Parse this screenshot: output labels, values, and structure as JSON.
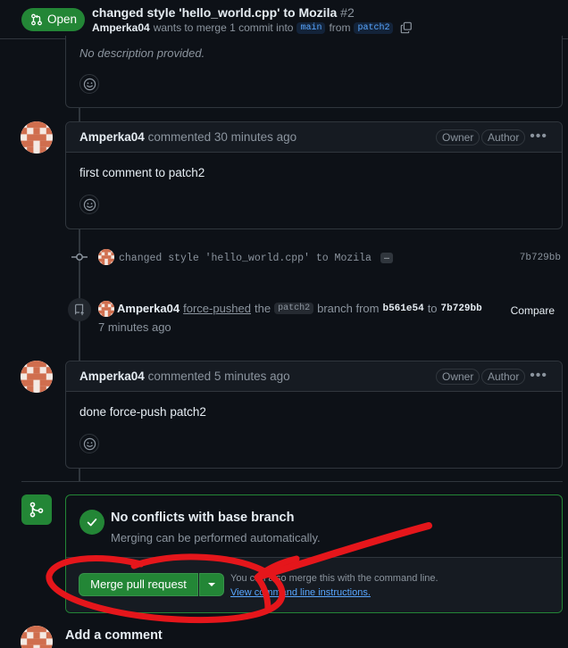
{
  "header": {
    "state": "Open",
    "title": "changed style 'hello_world.cpp' to Mozila",
    "number": "#2",
    "author": "Amperka04",
    "merge_text": "wants to merge 1 commit into",
    "base_branch": "main",
    "from_text": "from",
    "head_branch": "patch2"
  },
  "description": {
    "text": "No description provided."
  },
  "comments": [
    {
      "author": "Amperka04",
      "meta": "commented 30 minutes ago",
      "tags": [
        "Owner",
        "Author"
      ],
      "body": "first comment to patch2"
    },
    {
      "author": "Amperka04",
      "meta": "commented 5 minutes ago",
      "tags": [
        "Owner",
        "Author"
      ],
      "body": "done force-push patch2"
    }
  ],
  "commit_event": {
    "message": "changed style 'hello_world.cpp' to Mozila",
    "ellipsis": "…",
    "sha": "7b729bb"
  },
  "force_push": {
    "author": "Amperka04",
    "action": "force-pushed",
    "the_text": "the",
    "branch": "patch2",
    "branch_from_text": "branch from",
    "from_sha": "b561e54",
    "to_text": "to",
    "to_sha": "7b729bb",
    "time": "7 minutes ago",
    "compare_label": "Compare"
  },
  "merge": {
    "title": "No conflicts with base branch",
    "subtitle": "Merging can be performed automatically.",
    "button_label": "Merge pull request",
    "cli_text": "You can also merge this with the command line.",
    "cli_link": "View command line instructions."
  },
  "add_comment": {
    "title": "Add a comment"
  },
  "colors": {
    "background": "#0d1117",
    "surface": "#161b22",
    "border": "#30363d",
    "success": "#238636",
    "link": "#58a6ff",
    "muted": "#8b949e",
    "annotation": "#e5161b"
  }
}
